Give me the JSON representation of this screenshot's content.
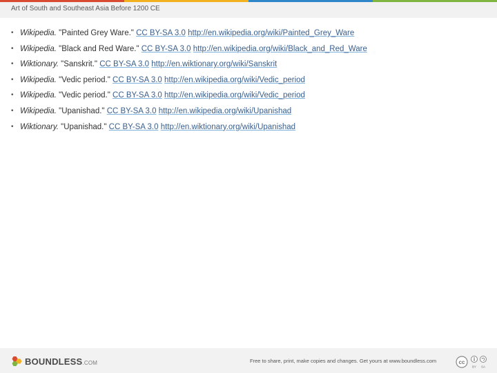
{
  "header": {
    "title": "Art of South and Southeast Asia Before 1200 CE"
  },
  "references": [
    {
      "source": "Wikipedia.",
      "title": " \"Painted Grey Ware.\"",
      "license": "CC BY-SA 3.0",
      "url": "http://en.wikipedia.org/wiki/Painted_Grey_Ware"
    },
    {
      "source": "Wikipedia.",
      "title": " \"Black and Red Ware.\"",
      "license": "CC BY-SA 3.0",
      "url": "http://en.wikipedia.org/wiki/Black_and_Red_Ware"
    },
    {
      "source": "Wiktionary.",
      "title": " \"Sanskrit.\"",
      "license": "CC BY-SA 3.0",
      "url": "http://en.wiktionary.org/wiki/Sanskrit"
    },
    {
      "source": "Wikipedia.",
      "title": " \"Vedic period.\"",
      "license": "CC BY-SA 3.0",
      "url": "http://en.wikipedia.org/wiki/Vedic_period"
    },
    {
      "source": "Wikipedia.",
      "title": " \"Vedic period.\"",
      "license": "CC BY-SA 3.0",
      "url": "http://en.wikipedia.org/wiki/Vedic_period"
    },
    {
      "source": "Wikipedia.",
      "title": " \"Upanishad.\"",
      "license": "CC BY-SA 3.0",
      "url": "http://en.wikipedia.org/wiki/Upanishad"
    },
    {
      "source": "Wiktionary.",
      "title": " \"Upanishad.\"",
      "license": "CC BY-SA 3.0",
      "url": "http://en.wiktionary.org/wiki/Upanishad"
    }
  ],
  "footer": {
    "logo_text": "BOUNDLESS",
    "logo_suffix": ".COM",
    "share_text": "Free to share, print, make copies and changes. Get yours at www.boundless.com",
    "cc_label": "cc",
    "by_label": "BY",
    "sa_label": "SA"
  },
  "colors": {
    "bar": [
      "#d84b30",
      "#f2b21f",
      "#2f87c9",
      "#7fb540"
    ],
    "link": "#3a5f8c",
    "link_underline": "#7fb2dc"
  },
  "icons": {
    "logo": "boundless-hexagon-icon",
    "license": "creative-commons-by-sa-icon"
  }
}
